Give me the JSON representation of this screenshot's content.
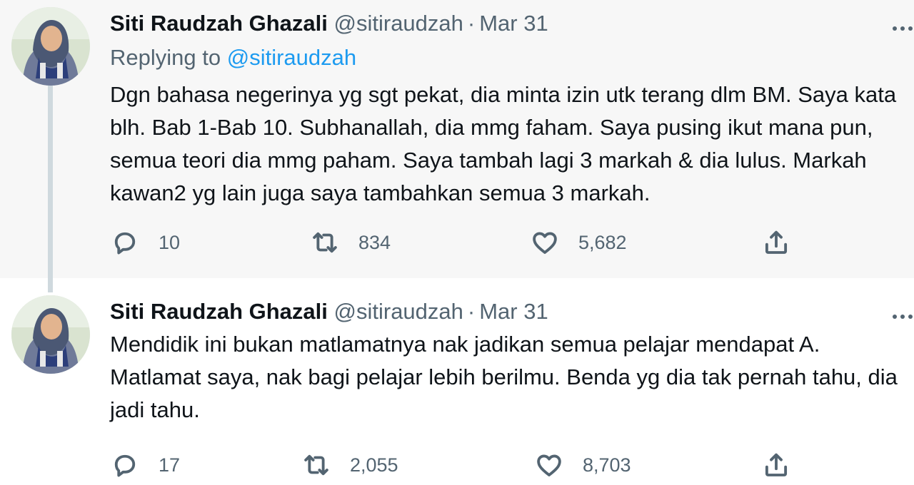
{
  "tweets": [
    {
      "author_name": "Siti Raudzah Ghazali",
      "author_handle": "@sitiraudzah",
      "separator": "·",
      "date": "Mar 31",
      "replying_label": "Replying to",
      "replying_handle": "@sitiraudzah",
      "text": "Dgn bahasa negerinya yg sgt pekat, dia minta izin utk terang dlm BM. Saya kata blh. Bab 1-Bab 10. Subhanallah, dia mmg faham. Saya pusing ikut mana pun, semua teori dia mmg paham. Saya tambah lagi 3 markah & dia lulus. Markah kawan2 yg lain juga saya tambahkan semua 3 markah.",
      "replies": "10",
      "retweets": "834",
      "likes": "5,682",
      "icons": [
        "reply-icon",
        "retweet-icon",
        "like-icon",
        "share-icon",
        "more-icon"
      ]
    },
    {
      "author_name": "Siti Raudzah Ghazali",
      "author_handle": "@sitiraudzah",
      "separator": "·",
      "date": "Mar 31",
      "text": "Mendidik ini bukan matlamatnya nak jadikan semua pelajar mendapat A. Matlamat saya, nak bagi pelajar lebih berilmu. Benda yg dia tak pernah tahu, dia jadi tahu.",
      "replies": "17",
      "retweets": "2,055",
      "likes": "8,703",
      "icons": [
        "reply-icon",
        "retweet-icon",
        "like-icon",
        "share-icon",
        "more-icon"
      ]
    }
  ],
  "colors": {
    "accent": "#1d9bf0",
    "secondary_text": "#536471",
    "primary_text": "#0f1419",
    "highlight_bg": "#f7f7f7",
    "thread_line": "#cfd9de"
  }
}
